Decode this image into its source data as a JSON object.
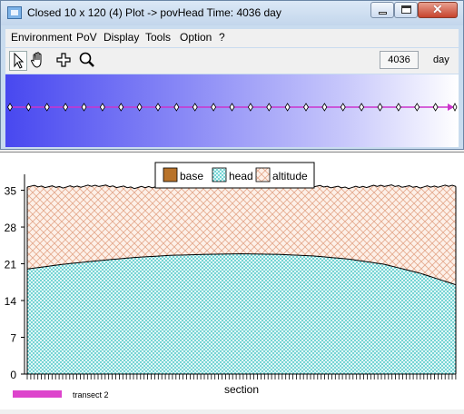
{
  "window": {
    "title": "Closed 10 x 120 (4)  Plot -> povHead  Time: 4036 day",
    "controls": {
      "minimize": "minimize",
      "maximize": "maximize",
      "close": "close"
    }
  },
  "menu": {
    "items": [
      "Environment",
      "PoV",
      "Display",
      "Tools",
      "Option",
      "?"
    ]
  },
  "toolbar": {
    "tools": [
      "pointer-icon",
      "hand-icon",
      "crosshair-icon",
      "zoom-icon"
    ],
    "time_value": "4036",
    "time_unit": "day"
  },
  "plan_view": {
    "marker_count": 25,
    "line_color": "#cc33cc"
  },
  "legend": [
    {
      "label": "base",
      "color": "#b8732b"
    },
    {
      "label": "head",
      "color": "#33cccc"
    },
    {
      "label": "altitude",
      "color": "#f5ddd0"
    }
  ],
  "transect_label": "transect 2",
  "transect_color": "#dd44cc",
  "chart_data": {
    "type": "area",
    "xlabel": "section",
    "ylabel": "",
    "ylim": [
      0,
      37
    ],
    "yticks": [
      "0",
      "7",
      "14",
      "21",
      "28",
      "35"
    ],
    "series": [
      {
        "name": "base",
        "values": [
          0,
          0,
          0,
          0,
          0,
          0,
          0,
          0,
          0,
          0,
          0,
          0,
          0
        ]
      },
      {
        "name": "head",
        "values": [
          20.0,
          20.9,
          21.6,
          22.2,
          22.6,
          22.8,
          22.9,
          22.8,
          22.5,
          21.9,
          20.9,
          19.2,
          17.0
        ]
      },
      {
        "name": "altitude",
        "values": [
          35.8,
          35.6,
          35.9,
          35.5,
          35.8,
          35.6,
          35.9,
          35.6,
          35.8,
          35.5,
          35.9,
          35.6,
          35.9
        ]
      }
    ],
    "grid": false,
    "legend_position": "top-center"
  }
}
